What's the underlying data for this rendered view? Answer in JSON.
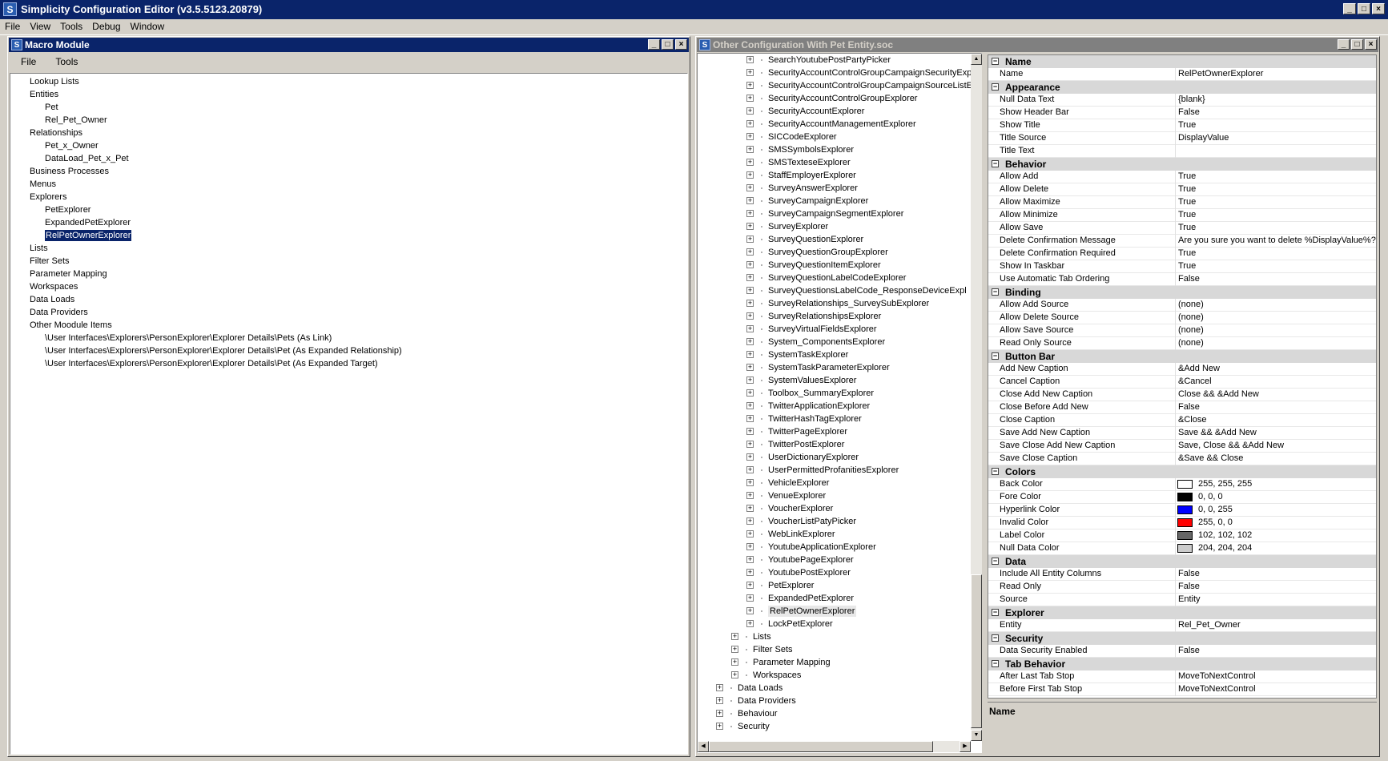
{
  "app": {
    "title": "Simplicity Configuration Editor (v3.5.5123.20879)",
    "icon": "S"
  },
  "menu": [
    "File",
    "View",
    "Tools",
    "Debug",
    "Window"
  ],
  "macro": {
    "title": "Macro Module",
    "menu": [
      "File",
      "Tools"
    ],
    "tree": [
      {
        "label": "Lookup Lists",
        "level": 0
      },
      {
        "label": "Entities",
        "level": 0
      },
      {
        "label": "Pet",
        "level": 1
      },
      {
        "label": "Rel_Pet_Owner",
        "level": 1
      },
      {
        "label": "Relationships",
        "level": 0
      },
      {
        "label": "Pet_x_Owner",
        "level": 1
      },
      {
        "label": "DataLoad_Pet_x_Pet",
        "level": 1
      },
      {
        "label": "Business Processes",
        "level": 0
      },
      {
        "label": "Menus",
        "level": 0
      },
      {
        "label": "Explorers",
        "level": 0
      },
      {
        "label": "PetExplorer",
        "level": 1
      },
      {
        "label": "ExpandedPetExplorer",
        "level": 1
      },
      {
        "label": "RelPetOwnerExplorer",
        "level": 1,
        "selected": true
      },
      {
        "label": "Lists",
        "level": 0
      },
      {
        "label": "Filter Sets",
        "level": 0
      },
      {
        "label": "Parameter Mapping",
        "level": 0
      },
      {
        "label": "Workspaces",
        "level": 0
      },
      {
        "label": "Data Loads",
        "level": 0
      },
      {
        "label": "Data Providers",
        "level": 0
      },
      {
        "label": "Other Moodule Items",
        "level": 0
      },
      {
        "label": "\\User Interfaces\\Explorers\\PersonExplorer\\Explorer Details\\Pets (As Link)",
        "level": 1
      },
      {
        "label": "\\User Interfaces\\Explorers\\PersonExplorer\\Explorer Details\\Pet (As Expanded Relationship)",
        "level": 1
      },
      {
        "label": "\\User Interfaces\\Explorers\\PersonExplorer\\Explorer Details\\Pet (As Expanded Target)",
        "level": 1
      }
    ]
  },
  "config": {
    "title": "Other Configuration With Pet Entity.soc",
    "tree": [
      {
        "label": "SearchYoutubePostPartyPicker",
        "level": 3
      },
      {
        "label": "SecurityAccountControlGroupCampaignSecurityExp",
        "level": 3
      },
      {
        "label": "SecurityAccountControlGroupCampaignSourceListE",
        "level": 3
      },
      {
        "label": "SecurityAccountControlGroupExplorer",
        "level": 3
      },
      {
        "label": "SecurityAccountExplorer",
        "level": 3
      },
      {
        "label": "SecurityAccountManagementExplorer",
        "level": 3
      },
      {
        "label": "SICCodeExplorer",
        "level": 3
      },
      {
        "label": "SMSSymbolsExplorer",
        "level": 3
      },
      {
        "label": "SMSTexteseExplorer",
        "level": 3
      },
      {
        "label": "StaffEmployerExplorer",
        "level": 3
      },
      {
        "label": "SurveyAnswerExplorer",
        "level": 3
      },
      {
        "label": "SurveyCampaignExplorer",
        "level": 3
      },
      {
        "label": "SurveyCampaignSegmentExplorer",
        "level": 3
      },
      {
        "label": "SurveyExplorer",
        "level": 3
      },
      {
        "label": "SurveyQuestionExplorer",
        "level": 3
      },
      {
        "label": "SurveyQuestionGroupExplorer",
        "level": 3
      },
      {
        "label": "SurveyQuestionItemExplorer",
        "level": 3
      },
      {
        "label": "SurveyQuestionLabelCodeExplorer",
        "level": 3
      },
      {
        "label": "SurveyQuestionsLabelCode_ResponseDeviceExpl",
        "level": 3
      },
      {
        "label": "SurveyRelationships_SurveySubExplorer",
        "level": 3
      },
      {
        "label": "SurveyRelationshipsExplorer",
        "level": 3
      },
      {
        "label": "SurveyVirtualFieldsExplorer",
        "level": 3
      },
      {
        "label": "System_ComponentsExplorer",
        "level": 3
      },
      {
        "label": "SystemTaskExplorer",
        "level": 3
      },
      {
        "label": "SystemTaskParameterExplorer",
        "level": 3
      },
      {
        "label": "SystemValuesExplorer",
        "level": 3
      },
      {
        "label": "Toolbox_SummaryExplorer",
        "level": 3
      },
      {
        "label": "TwitterApplicationExplorer",
        "level": 3
      },
      {
        "label": "TwitterHashTagExplorer",
        "level": 3
      },
      {
        "label": "TwitterPageExplorer",
        "level": 3
      },
      {
        "label": "TwitterPostExplorer",
        "level": 3
      },
      {
        "label": "UserDictionaryExplorer",
        "level": 3
      },
      {
        "label": "UserPermittedProfanitiesExplorer",
        "level": 3
      },
      {
        "label": "VehicleExplorer",
        "level": 3
      },
      {
        "label": "VenueExplorer",
        "level": 3
      },
      {
        "label": "VoucherExplorer",
        "level": 3
      },
      {
        "label": "VoucherListPatyPicker",
        "level": 3
      },
      {
        "label": "WebLinkExplorer",
        "level": 3
      },
      {
        "label": "YoutubeApplicationExplorer",
        "level": 3
      },
      {
        "label": "YoutubePageExplorer",
        "level": 3
      },
      {
        "label": "YoutubePostExplorer",
        "level": 3
      },
      {
        "label": "PetExplorer",
        "level": 3
      },
      {
        "label": "ExpandedPetExplorer",
        "level": 3
      },
      {
        "label": "RelPetOwnerExplorer",
        "level": 3,
        "highlight": true
      },
      {
        "label": "LockPetExplorer",
        "level": 3
      },
      {
        "label": "Lists",
        "level": 2
      },
      {
        "label": "Filter Sets",
        "level": 2
      },
      {
        "label": "Parameter Mapping",
        "level": 2
      },
      {
        "label": "Workspaces",
        "level": 2
      },
      {
        "label": "Data Loads",
        "level": 1
      },
      {
        "label": "Data Providers",
        "level": 1
      },
      {
        "label": "Behaviour",
        "level": 1
      },
      {
        "label": "Security",
        "level": 1
      }
    ]
  },
  "properties": [
    {
      "cat": "Name",
      "rows": [
        {
          "k": "Name",
          "v": "RelPetOwnerExplorer"
        }
      ]
    },
    {
      "cat": "Appearance",
      "rows": [
        {
          "k": "Null Data Text",
          "v": "{blank}"
        },
        {
          "k": "Show Header Bar",
          "v": "False"
        },
        {
          "k": "Show Title",
          "v": "True"
        },
        {
          "k": "Title Source",
          "v": "DisplayValue"
        },
        {
          "k": "Title Text",
          "v": ""
        }
      ]
    },
    {
      "cat": "Behavior",
      "rows": [
        {
          "k": "Allow Add",
          "v": "True"
        },
        {
          "k": "Allow Delete",
          "v": "True"
        },
        {
          "k": "Allow Maximize",
          "v": "True"
        },
        {
          "k": "Allow Minimize",
          "v": "True"
        },
        {
          "k": "Allow Save",
          "v": "True"
        },
        {
          "k": "Delete Confirmation Message",
          "v": "Are you sure you want to delete %DisplayValue%?"
        },
        {
          "k": "Delete Confirmation Required",
          "v": "True"
        },
        {
          "k": "Show In Taskbar",
          "v": "True"
        },
        {
          "k": "Use Automatic Tab Ordering",
          "v": "False"
        }
      ]
    },
    {
      "cat": "Binding",
      "rows": [
        {
          "k": "Allow Add Source",
          "v": "(none)"
        },
        {
          "k": "Allow Delete Source",
          "v": "(none)"
        },
        {
          "k": "Allow Save Source",
          "v": "(none)"
        },
        {
          "k": "Read Only Source",
          "v": "(none)"
        }
      ]
    },
    {
      "cat": "Button Bar",
      "rows": [
        {
          "k": "Add New Caption",
          "v": "&Add New"
        },
        {
          "k": "Cancel Caption",
          "v": "&Cancel"
        },
        {
          "k": "Close Add New Caption",
          "v": "Close && &Add New"
        },
        {
          "k": "Close Before Add New",
          "v": "False"
        },
        {
          "k": "Close Caption",
          "v": "&Close"
        },
        {
          "k": "Save Add New Caption",
          "v": "Save && &Add New"
        },
        {
          "k": "Save Close Add New Caption",
          "v": "Save, Close && &Add New"
        },
        {
          "k": "Save Close Caption",
          "v": "&Save && Close"
        }
      ]
    },
    {
      "cat": "Colors",
      "rows": [
        {
          "k": "Back Color",
          "v": "255, 255, 255",
          "swatch": "#ffffff"
        },
        {
          "k": "Fore Color",
          "v": "0, 0, 0",
          "swatch": "#000000"
        },
        {
          "k": "Hyperlink Color",
          "v": "0, 0, 255",
          "swatch": "#0000ff"
        },
        {
          "k": "Invalid Color",
          "v": "255, 0, 0",
          "swatch": "#ff0000"
        },
        {
          "k": "Label Color",
          "v": "102, 102, 102",
          "swatch": "#666666"
        },
        {
          "k": "Null Data Color",
          "v": "204, 204, 204",
          "swatch": "#cccccc"
        }
      ]
    },
    {
      "cat": "Data",
      "rows": [
        {
          "k": "Include All Entity Columns",
          "v": "False"
        },
        {
          "k": "Read Only",
          "v": "False"
        },
        {
          "k": "Source",
          "v": "Entity"
        }
      ]
    },
    {
      "cat": "Explorer",
      "rows": [
        {
          "k": "Entity",
          "v": "Rel_Pet_Owner"
        }
      ]
    },
    {
      "cat": "Security",
      "rows": [
        {
          "k": "Data Security Enabled",
          "v": "False"
        }
      ]
    },
    {
      "cat": "Tab Behavior",
      "rows": [
        {
          "k": "After Last Tab Stop",
          "v": "MoveToNextControl"
        },
        {
          "k": "Before First Tab Stop",
          "v": "MoveToNextControl"
        }
      ]
    }
  ],
  "description": {
    "title": "Name"
  },
  "glyphs": {
    "minimize": "_",
    "maximize": "□",
    "close": "×",
    "plus": "+",
    "minus": "−",
    "up": "▲",
    "down": "▼",
    "left": "◀",
    "right": "▶"
  }
}
